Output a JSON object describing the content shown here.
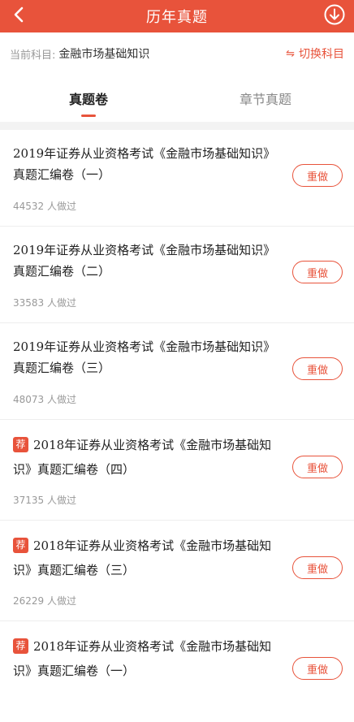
{
  "header": {
    "title": "历年真题",
    "back_icon": "chevron-left-icon",
    "download_icon": "download-circle-icon",
    "bg_color": "#e8533b"
  },
  "subject": {
    "label": "当前科目:",
    "value": "金融市场基础知识",
    "switch_label": "切换科目",
    "switch_icon": "swap-icon"
  },
  "tabs": [
    {
      "label": "真题卷",
      "active": true
    },
    {
      "label": "章节真题",
      "active": false
    }
  ],
  "items": [
    {
      "badge": "",
      "name": "2019年证券从业资格考试《金融市场基础知识》真题汇编卷（一）",
      "count": "44532 人做过",
      "action": "重做"
    },
    {
      "badge": "",
      "name": "2019年证券从业资格考试《金融市场基础知识》真题汇编卷（二）",
      "count": "33583 人做过",
      "action": "重做"
    },
    {
      "badge": "",
      "name": "2019年证券从业资格考试《金融市场基础知识》真题汇编卷（三）",
      "count": "48073 人做过",
      "action": "重做"
    },
    {
      "badge": "荐",
      "name": "2018年证券从业资格考试《金融市场基础知识》真题汇编卷（四）",
      "count": "37135 人做过",
      "action": "重做"
    },
    {
      "badge": "荐",
      "name": "2018年证券从业资格考试《金融市场基础知识》真题汇编卷（三）",
      "count": "26229 人做过",
      "action": "重做"
    },
    {
      "badge": "荐",
      "name": "2018年证券从业资格考试《金融市场基础知识》真题汇编卷（一）",
      "count": "",
      "action": "重做"
    }
  ]
}
